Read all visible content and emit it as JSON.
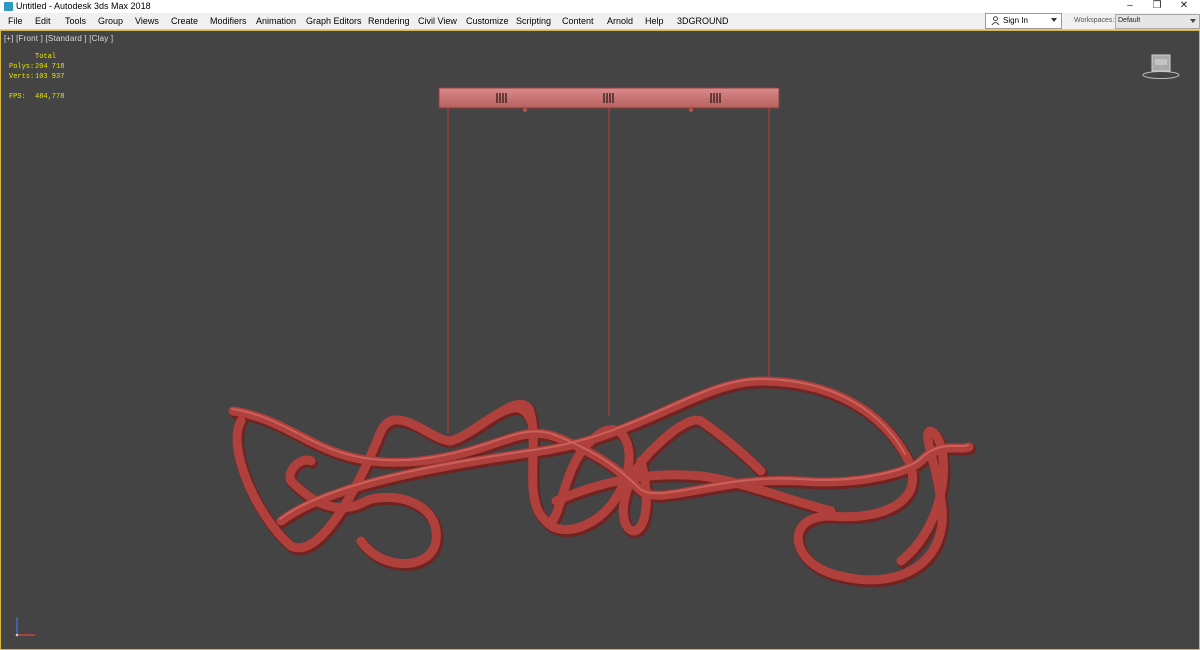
{
  "window": {
    "title": "Untitled - Autodesk 3ds Max 2018",
    "minimize": "–",
    "maximize": "❐",
    "close": "✕"
  },
  "menu": [
    "File",
    "Edit",
    "Tools",
    "Group",
    "Views",
    "Create",
    "Modifiers",
    "Animation",
    "Graph Editors",
    "Rendering",
    "Civil View",
    "Customize",
    "Scripting",
    "Content",
    "Arnold",
    "Help",
    "3DGROUND"
  ],
  "account": {
    "sign_in": "Sign In"
  },
  "workspaces": {
    "label": "Workspaces:",
    "value": "Default"
  },
  "viewport": {
    "label": "[+] [Front ] [Standard ] [Clay ]",
    "stats": {
      "total": "Total",
      "polys_label": "Polys:",
      "polys_value": "204 718",
      "verts_label": "Verts:",
      "verts_value": "103 937",
      "fps_label": "FPS:",
      "fps_value": "484,778"
    }
  },
  "colors": {
    "viewport_bg": "#444444",
    "model": "#b0403c",
    "active_border": "#d7b74a",
    "stats_text": "#e6e600"
  }
}
